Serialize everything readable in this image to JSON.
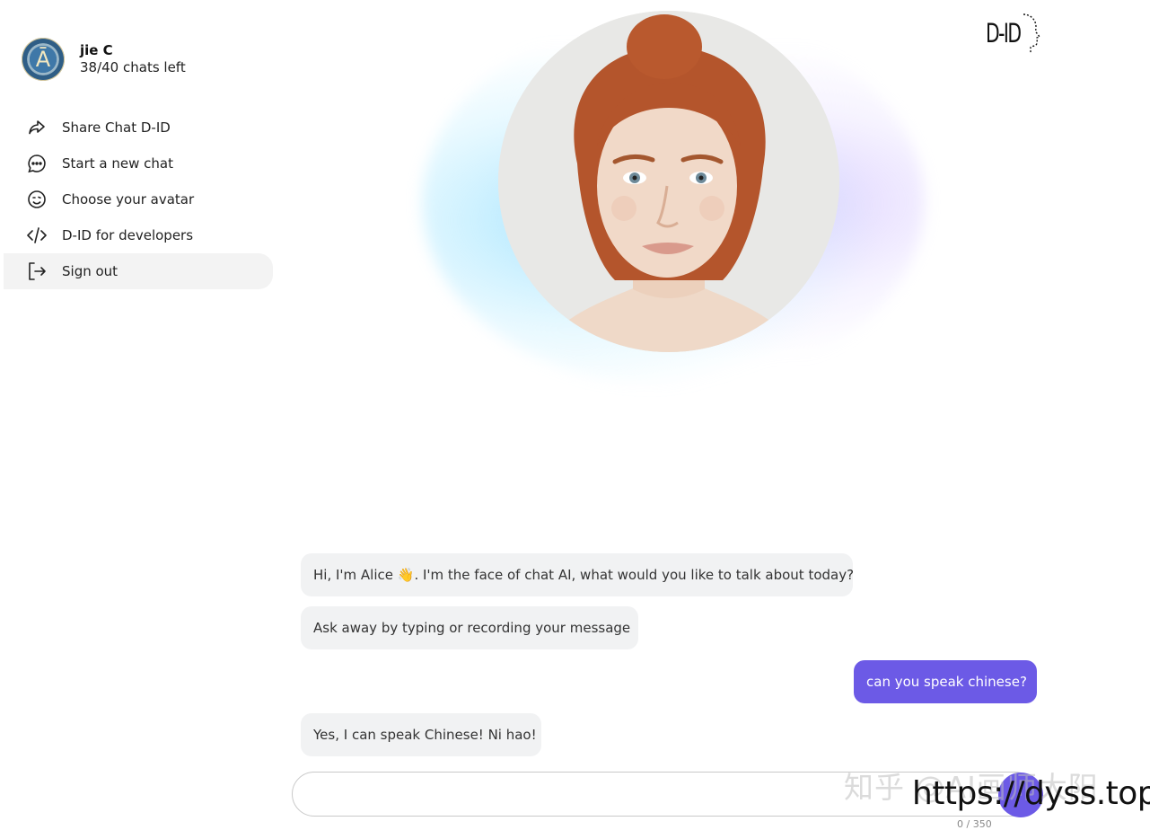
{
  "user": {
    "name": "jie C",
    "chats_left": "38/40 chats left",
    "avatar_icon": "seal-avatar-icon"
  },
  "menu": {
    "items": [
      {
        "label": "Share Chat D-ID",
        "icon": "share-icon"
      },
      {
        "label": "Start a new chat",
        "icon": "chat-bubble-icon"
      },
      {
        "label": "Choose your avatar",
        "icon": "smiley-icon"
      },
      {
        "label": "D-ID for developers",
        "icon": "code-icon"
      },
      {
        "label": "Sign out",
        "icon": "sign-out-icon",
        "active": true
      }
    ]
  },
  "brand": {
    "logo_text": "D-ID"
  },
  "messages": [
    {
      "role": "bot",
      "text_before": "Hi, I'm Alice ",
      "emoji": "👋",
      "text_after": ". I'm the face of chat AI, what would you like to talk about today?"
    },
    {
      "role": "bot",
      "text": "Ask away by typing or recording your message"
    },
    {
      "role": "user",
      "text": "can you speak chinese?"
    },
    {
      "role": "bot",
      "text": "Yes, I can speak Chinese! Ni hao!"
    }
  ],
  "composer": {
    "value": "",
    "counter": "0 / 350"
  },
  "watermark": {
    "cn": "知乎 @AI画师大阳",
    "url": "https://dyss.top"
  },
  "colors": {
    "accent": "#6c5ae6",
    "bot_bubble": "#f1f2f3",
    "active_menu": "#f3f3f3"
  }
}
